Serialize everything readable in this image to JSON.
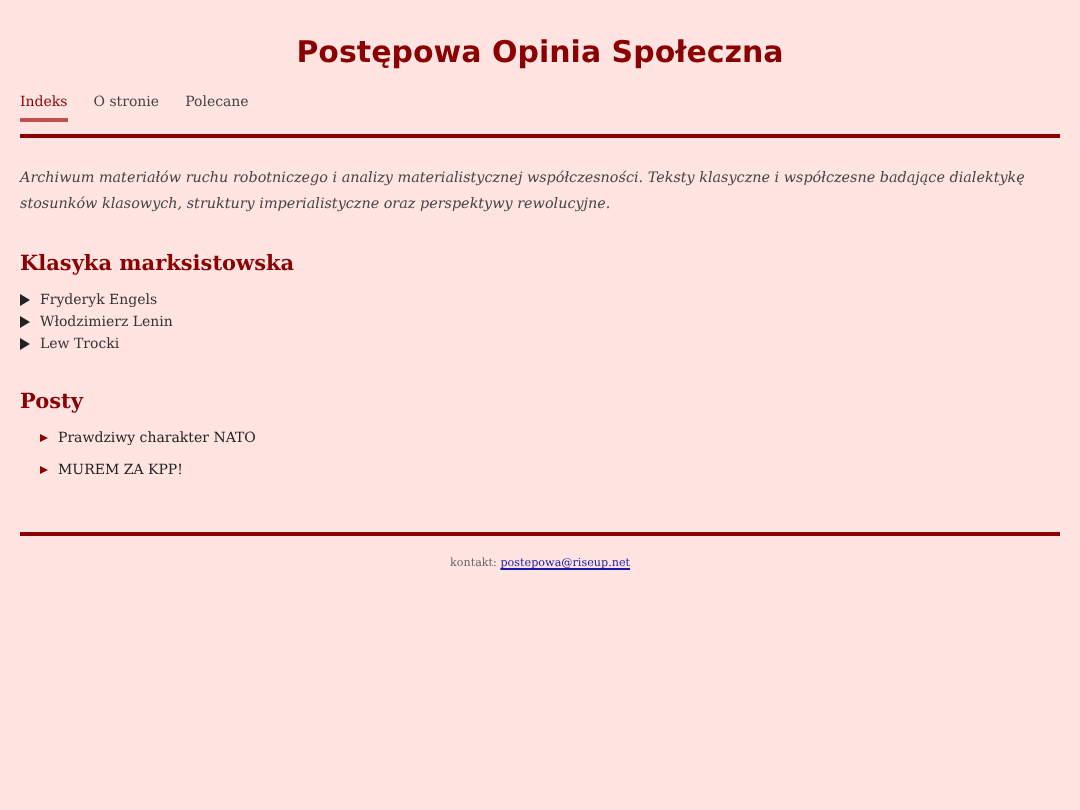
{
  "site_title": "Postępowa Opinia Społeczna",
  "nav": [
    {
      "label": "Indeks",
      "selected": true
    },
    {
      "label": "O stronie",
      "selected": false
    },
    {
      "label": "Polecane",
      "selected": false
    }
  ],
  "intro": "Archiwum materiałów ruchu robotniczego i analizy materialistycznej współczesności. Teksty klasyczne i współczesne badające dialektykę stosunków klasowych, struktury imperialistyczne oraz perspektywy rewolucyjne.",
  "classics": {
    "heading": "Klasyka marksistowska",
    "items": [
      {
        "label": "Fryderyk Engels",
        "expanded": false
      },
      {
        "label": "Włodzimierz Lenin",
        "expanded": false
      },
      {
        "label": "Lew Trocki",
        "expanded": false
      }
    ]
  },
  "posts": {
    "heading": "Posty",
    "items": [
      "Prawdziwy charakter NATO",
      "MUREM ZA KPP!"
    ]
  },
  "footer": {
    "label": "kontakt:",
    "email": "postepowa@riseup.net"
  }
}
